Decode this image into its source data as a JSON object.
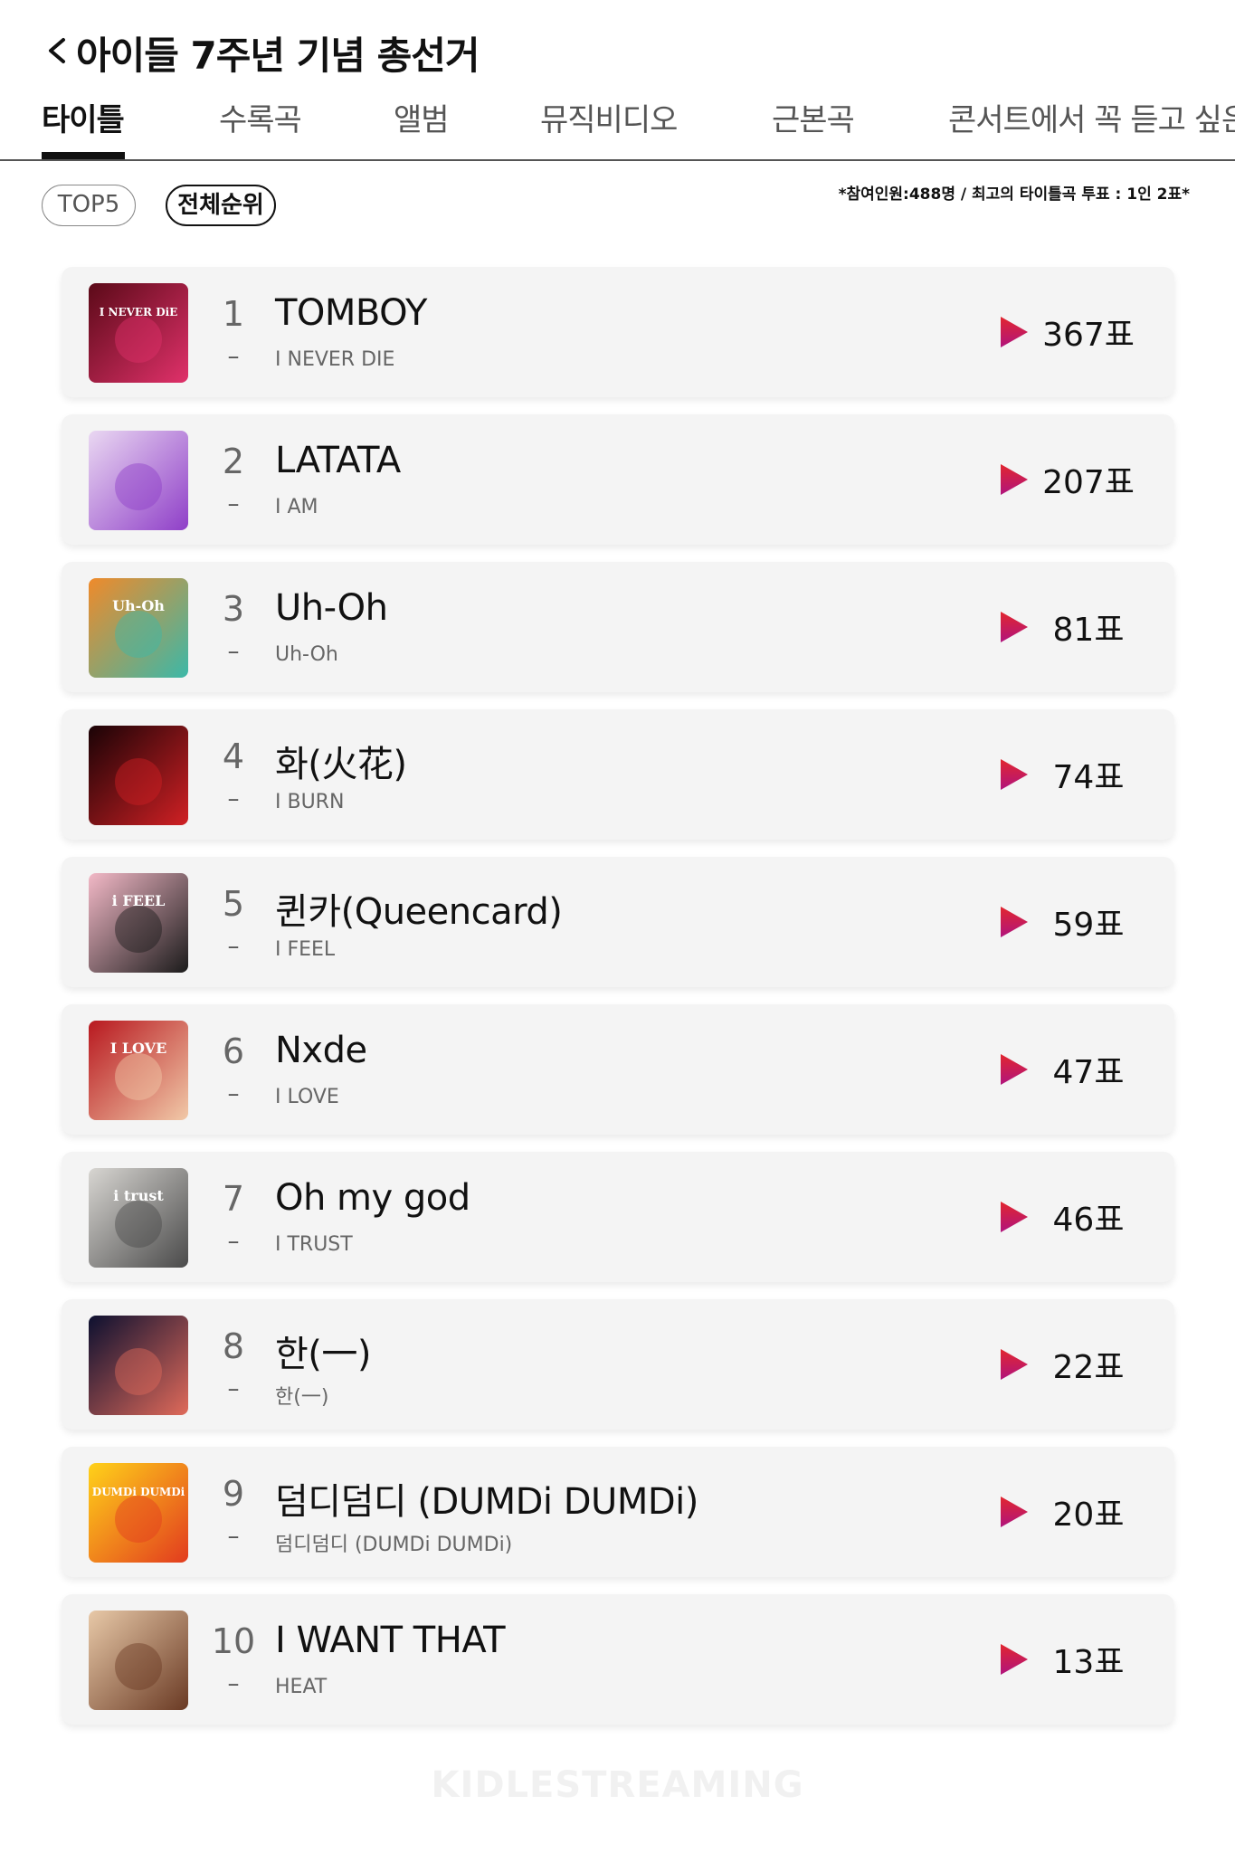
{
  "header": {
    "back_label": "<",
    "title": "아이들 7주년 기념 총선거"
  },
  "tabs": [
    {
      "label": "타이틀",
      "active": true
    },
    {
      "label": "수록곡",
      "active": false
    },
    {
      "label": "앨범",
      "active": false
    },
    {
      "label": "뮤직비디오",
      "active": false
    },
    {
      "label": "근본곡",
      "active": false
    },
    {
      "label": "콘서트에서 꼭 듣고 싶은",
      "active": false
    }
  ],
  "filters": {
    "top5_label": "TOP5",
    "all_label": "전체순위",
    "selected": "전체순위"
  },
  "note": "*참여인원:488명 / 최고의 타이틀곡 투표 : 1인 2표*",
  "colors": {
    "play_gradient_start": "#e2262e",
    "play_gradient_end": "#b0147e",
    "card_bg": "#f4f4f4"
  },
  "rankings": [
    {
      "rank": "1",
      "change": "–",
      "title": "TOMBOY",
      "album": "I NEVER DIE",
      "votes": "367표",
      "cover_label": "I NEVER DiE",
      "cover_colors": [
        "#5b0a18",
        "#e0316a"
      ]
    },
    {
      "rank": "2",
      "change": "–",
      "title": "LATATA",
      "album": "I AM",
      "votes": "207표",
      "cover_label": "",
      "cover_colors": [
        "#ead8f2",
        "#8f3fc8"
      ]
    },
    {
      "rank": "3",
      "change": "–",
      "title": "Uh-Oh",
      "album": "Uh-Oh",
      "votes": "81표",
      "cover_label": "Uh-Oh",
      "cover_colors": [
        "#f08a2a",
        "#3bb8a8"
      ]
    },
    {
      "rank": "4",
      "change": "–",
      "title": "화(火花)",
      "album": "I BURN",
      "votes": "74표",
      "cover_label": "",
      "cover_colors": [
        "#1a0306",
        "#d02024"
      ]
    },
    {
      "rank": "5",
      "change": "–",
      "title": "퀸카(Queencard)",
      "album": "I FEEL",
      "votes": "59표",
      "cover_label": "i FEEL",
      "cover_colors": [
        "#f3b9c7",
        "#1b1b1b"
      ]
    },
    {
      "rank": "6",
      "change": "–",
      "title": "Nxde",
      "album": "I LOVE",
      "votes": "47표",
      "cover_label": "I LOVE",
      "cover_colors": [
        "#b8181f",
        "#f1c9a8"
      ]
    },
    {
      "rank": "7",
      "change": "–",
      "title": "Oh my god",
      "album": "I TRUST",
      "votes": "46표",
      "cover_label": "i trust",
      "cover_colors": [
        "#d8d6d2",
        "#4a4a4a"
      ]
    },
    {
      "rank": "8",
      "change": "–",
      "title": "한(一)",
      "album": "한(一)",
      "votes": "22표",
      "cover_label": "",
      "cover_colors": [
        "#0c1030",
        "#e06a5a"
      ]
    },
    {
      "rank": "9",
      "change": "–",
      "title": "덤디덤디 (DUMDi DUMDi)",
      "album": "덤디덤디 (DUMDi DUMDi)",
      "votes": "20표",
      "cover_label": "DUMDi DUMDi",
      "cover_colors": [
        "#ffd21a",
        "#e23b1e"
      ]
    },
    {
      "rank": "10",
      "change": "–",
      "title": "I WANT THAT",
      "album": "HEAT",
      "votes": "13표",
      "cover_label": "",
      "cover_colors": [
        "#e8c9a8",
        "#6a3a24"
      ]
    }
  ],
  "watermark": "KIDLESTREAMING"
}
